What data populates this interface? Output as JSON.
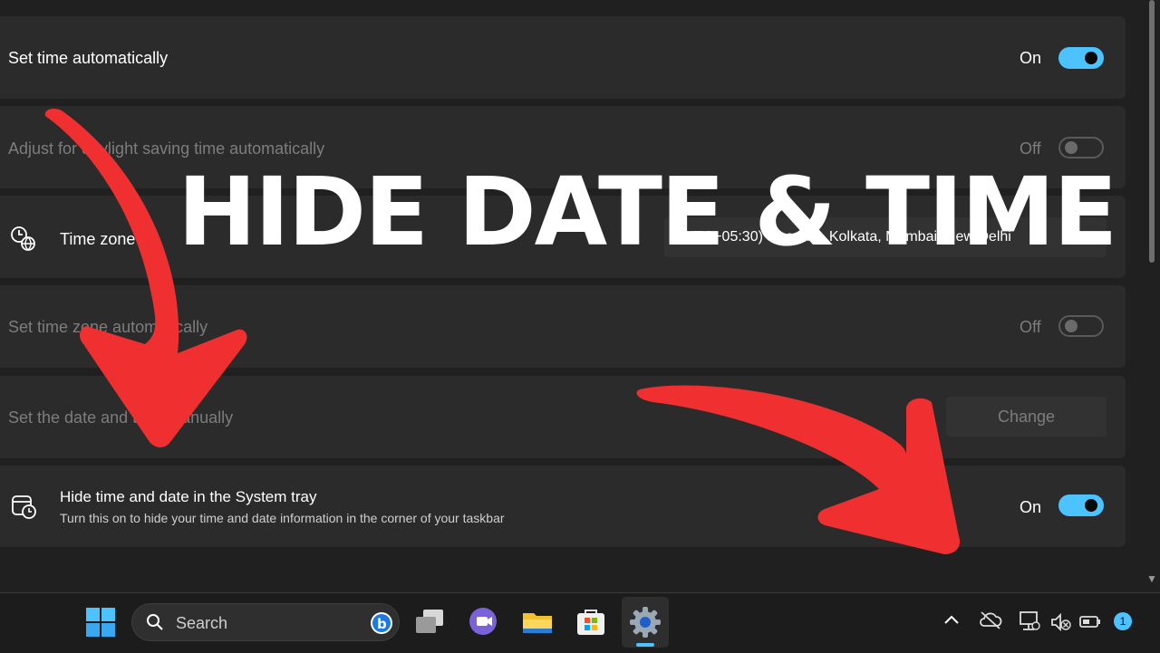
{
  "settings": {
    "set_time_automatically": {
      "label": "Set time automatically",
      "state": "On"
    },
    "dst": {
      "label": "Adjust for daylight saving time automatically",
      "state": "Off"
    },
    "time_zone": {
      "label": "Time zone",
      "value": "(UTC+05:30) Chennai, Kolkata, Mumbai, New Delhi"
    },
    "set_time_zone_auto": {
      "label": "Set time zone automatically",
      "state": "Off"
    },
    "set_date_manual": {
      "label": "Set the date and time manually",
      "button": "Change"
    },
    "hide_time_date": {
      "label": "Hide time and date in the System tray",
      "description": "Turn this on to hide your time and date information in the corner of your taskbar",
      "state": "On"
    }
  },
  "overlay": {
    "headline": "HIDE DATE & TIME"
  },
  "taskbar": {
    "search_label": "Search",
    "notification_count": "1",
    "apps": [
      "windows-start",
      "task-view",
      "teams-chat",
      "file-explorer",
      "microsoft-store",
      "settings"
    ]
  },
  "colors": {
    "accent": "#4cc2ff",
    "arrow": "#f03030",
    "background": "#202020",
    "panel": "#2b2b2b"
  }
}
